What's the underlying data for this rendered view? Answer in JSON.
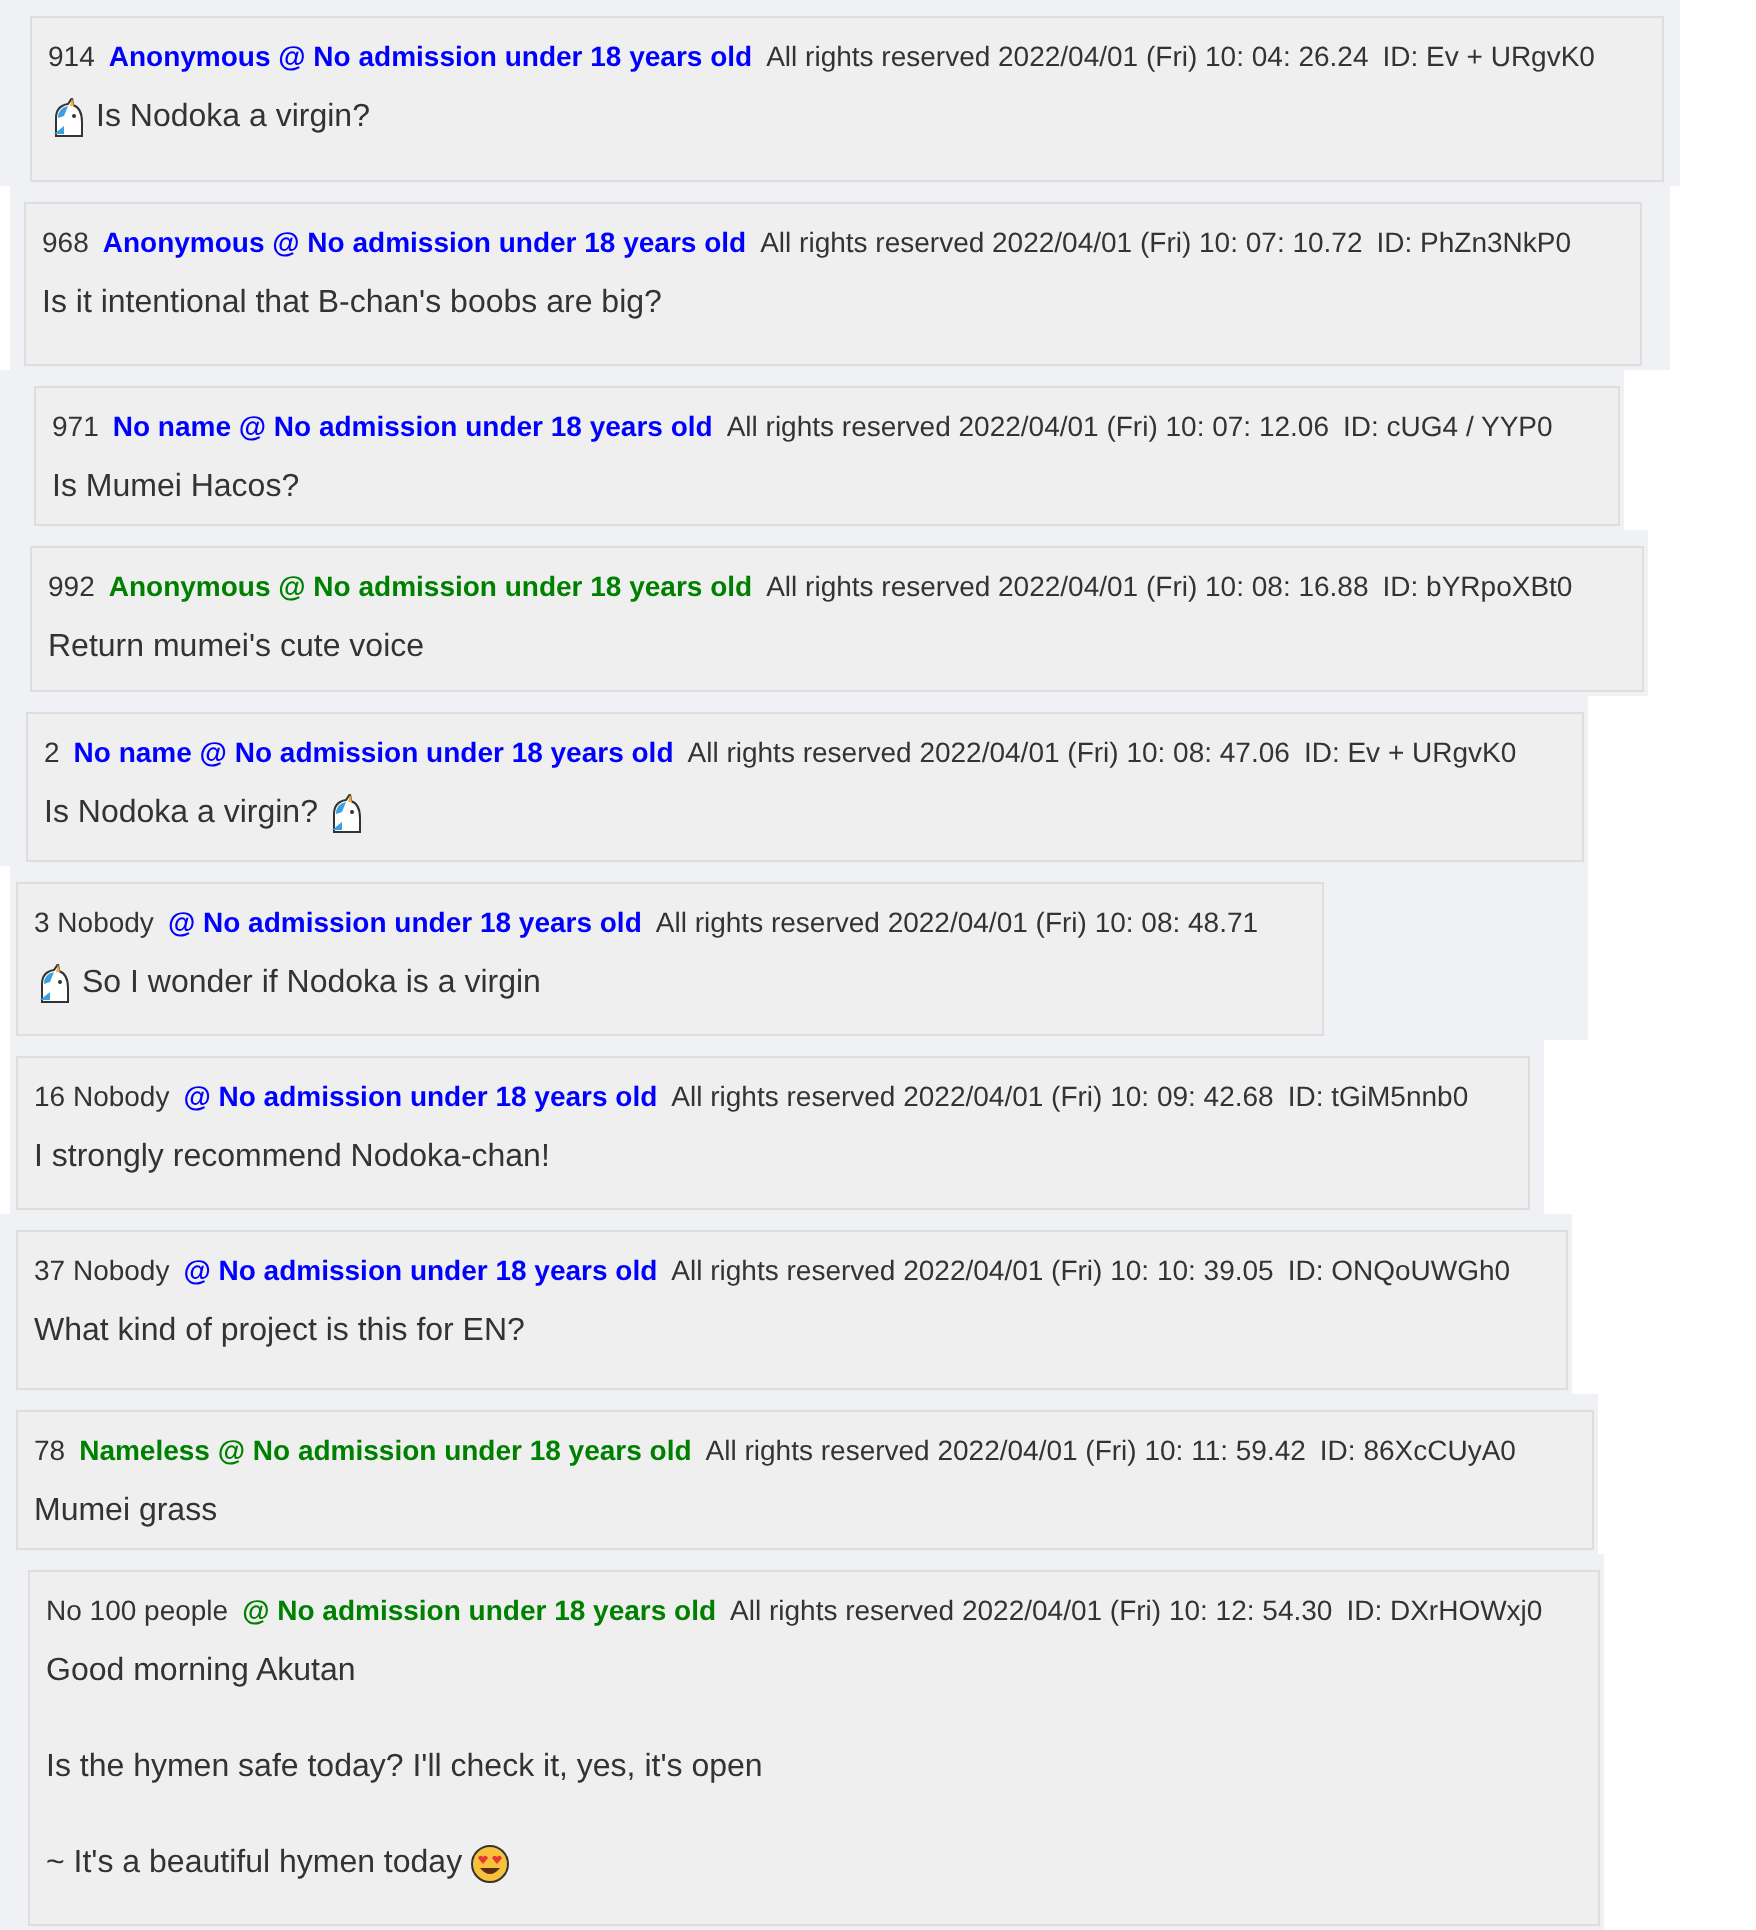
{
  "posts": [
    {
      "number": "914",
      "handle": "Anonymous @ No admission under 18 years old",
      "color": "#0000ff",
      "date": "All rights reserved 2022/04/01 (Fri) 10: 04: 26.24",
      "id": "ID: Ev + URgvK0",
      "lines": [
        [
          {
            "kind": "unicorn"
          },
          {
            "kind": "text",
            "text": "Is Nodoka a virgin?"
          }
        ]
      ]
    },
    {
      "number": "968",
      "handle": "Anonymous @ No admission under 18 years old",
      "color": "#0000ff",
      "date": "All rights reserved 2022/04/01 (Fri) 10: 07: 10.72",
      "id": "ID: PhZn3NkP0",
      "lines": [
        [
          {
            "kind": "text",
            "text": "Is it intentional that B-chan's boobs are big?"
          }
        ]
      ]
    },
    {
      "number": "971",
      "handle": "No name @ No admission under 18 years old",
      "color": "#0000ff",
      "date": "All rights reserved 2022/04/01 (Fri) 10: 07: 12.06",
      "id": "ID: cUG4 / YYP0",
      "lines": [
        [
          {
            "kind": "text",
            "text": "Is Mumei Hacos?"
          }
        ]
      ]
    },
    {
      "number": "992",
      "handle": "Anonymous @ No admission under 18 years old",
      "color": "#008000",
      "date": "All rights reserved 2022/04/01 (Fri) 10: 08: 16.88",
      "id": "ID: bYRpoXBt0",
      "lines": [
        [
          {
            "kind": "text",
            "text": "Return mumei's cute voice"
          }
        ]
      ]
    },
    {
      "number": "2",
      "handle": "No name @ No admission under 18 years old",
      "color": "#0000ff",
      "date": "All rights reserved 2022/04/01 (Fri) 10: 08: 47.06",
      "id": "ID: Ev + URgvK0",
      "lines": [
        [
          {
            "kind": "text",
            "text": "Is Nodoka a virgin?"
          },
          {
            "kind": "unicorn"
          }
        ]
      ]
    },
    {
      "number": "3 Nobody",
      "handle": "@ No admission under 18 years old",
      "color": "#0000ff",
      "date": "All rights reserved 2022/04/01 (Fri) 10: 08: 48.71",
      "lines": [
        [
          {
            "kind": "unicorn"
          },
          {
            "kind": "text",
            "text": "So I wonder if Nodoka is a virgin"
          }
        ]
      ]
    },
    {
      "number": "16 Nobody",
      "handle": "@ No admission under 18 years old",
      "color": "#0000ff",
      "date": "All rights reserved 2022/04/01 (Fri) 10: 09: 42.68",
      "id": "ID: tGiM5nnb0",
      "lines": [
        [
          {
            "kind": "text",
            "text": "I strongly recommend Nodoka-chan!"
          }
        ]
      ]
    },
    {
      "number": "37 Nobody",
      "handle": "@ No admission under 18 years old",
      "color": "#0000ff",
      "date": "All rights reserved 2022/04/01 (Fri) 10: 10: 39.05",
      "id": "ID: ONQoUWGh0",
      "lines": [
        [
          {
            "kind": "text",
            "text": "What kind of project is this for EN?"
          }
        ]
      ]
    },
    {
      "number": "78",
      "handle": "Nameless @ No admission under 18 years old",
      "color": "#008000",
      "date": "All rights reserved 2022/04/01 (Fri) 10: 11: 59.42",
      "id": "ID: 86XcCUyA0",
      "lines": [
        [
          {
            "kind": "text",
            "text": "Mumei grass"
          }
        ]
      ]
    },
    {
      "number": "No 100 people",
      "handle": "@ No admission under 18 years old",
      "color": "#008000",
      "date": "All rights reserved 2022/04/01 (Fri) 10: 12: 54.30",
      "id": "ID: DXrHOWxj0",
      "lines": [
        [
          {
            "kind": "text",
            "text": "Good morning Akutan"
          }
        ],
        [
          {
            "kind": "text",
            "text": "Is the hymen safe today? I'll check it, yes, it's open"
          }
        ],
        [
          {
            "kind": "text",
            "text": "~ It's a beautiful hymen today"
          },
          {
            "kind": "heart-eyes"
          }
        ]
      ]
    }
  ]
}
